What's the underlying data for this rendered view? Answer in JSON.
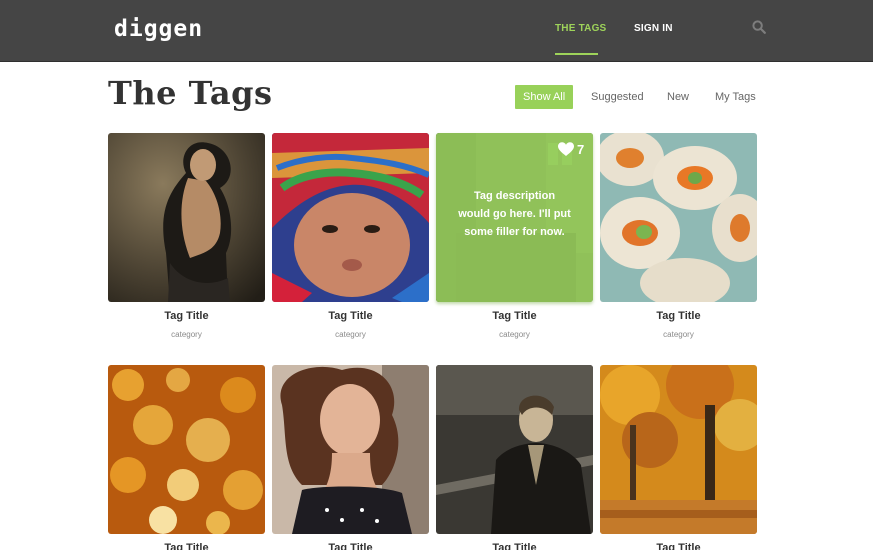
{
  "brand": {
    "name": "diggen",
    "accent": "#98d159",
    "header_bg": "#454545"
  },
  "nav": {
    "items": [
      {
        "label": "THE TAGS",
        "active": true
      },
      {
        "label": "SIGN IN",
        "active": false
      }
    ],
    "search_icon": "search-icon"
  },
  "page": {
    "title": "The Tags"
  },
  "filters": [
    {
      "label": "Show All",
      "active": true
    },
    {
      "label": "Suggested",
      "active": false
    },
    {
      "label": "New",
      "active": false
    },
    {
      "label": "My Tags",
      "active": false
    }
  ],
  "cards": [
    {
      "title": "Tag Title",
      "category": "category",
      "image": "woman in dark dress"
    },
    {
      "title": "Tag Title",
      "category": "category",
      "image": "child with knitted hat"
    },
    {
      "title": "Tag Title",
      "category": "category",
      "image": "city street",
      "hovered": true,
      "description": "Tag description would go here. I'll put some filler for now.",
      "likes": "7",
      "like_icon": "heart-icon"
    },
    {
      "title": "Tag Title",
      "category": "category",
      "image": "sushi rolls"
    },
    {
      "title": "Tag Title",
      "category": "",
      "image": "golden bokeh lights"
    },
    {
      "title": "Tag Title",
      "category": "",
      "image": "woman with curly hair"
    },
    {
      "title": "Tag Title",
      "category": "",
      "image": "man in leather jacket"
    },
    {
      "title": "Tag Title",
      "category": "",
      "image": "autumn forest"
    }
  ]
}
